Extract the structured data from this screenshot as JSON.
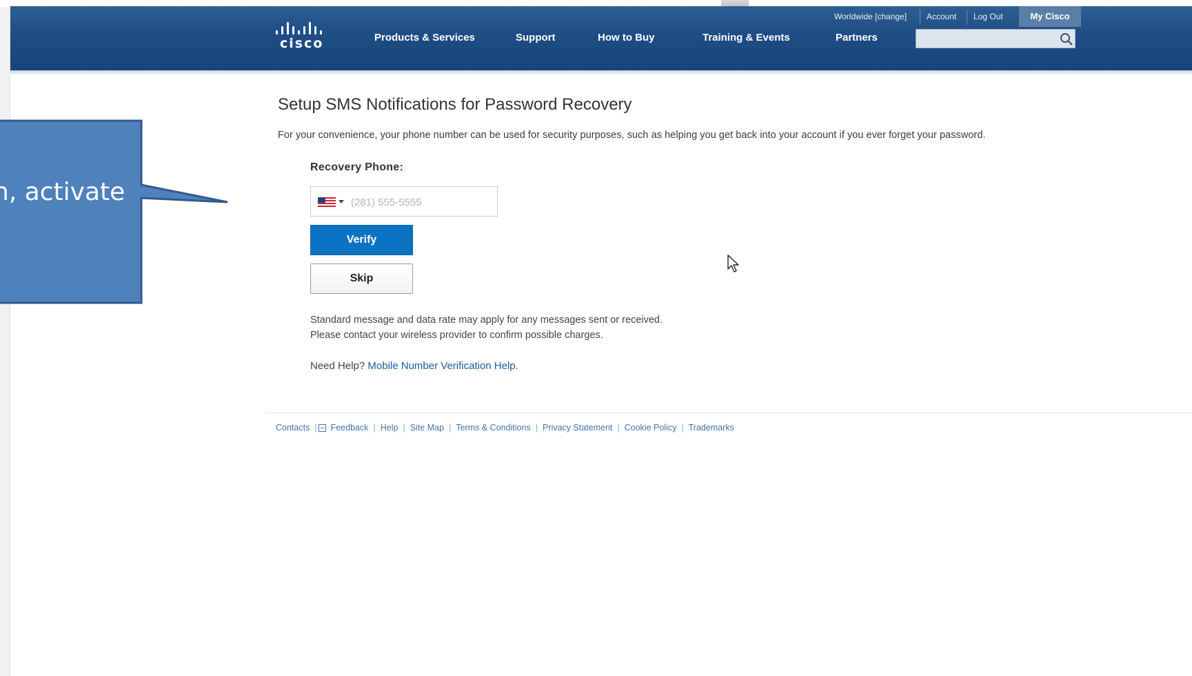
{
  "header": {
    "logo_text": "cisco",
    "nav": [
      "Products & Services",
      "Support",
      "How to Buy",
      "Training & Events",
      "Partners"
    ],
    "utility": {
      "worldwide": "Worldwide [change]",
      "account": "Account",
      "logout": "Log Out",
      "my_cisco": "My Cisco"
    },
    "search": {
      "placeholder": "",
      "icon": "search-icon"
    }
  },
  "main": {
    "title": "Setup SMS Notifications for Password Recovery",
    "intro": "For your convenience, your phone number can be used for security purposes, such as helping you get back into your account if you ever forget your password.",
    "recovery_label": "Recovery Phone:",
    "phone": {
      "placeholder": "(281) 555-5555",
      "country_icon": "us-flag-icon"
    },
    "verify_label": "Verify",
    "skip_label": "Skip",
    "disclaimer_line1": "Standard message and data rate may apply for any messages sent or received.",
    "disclaimer_line2": "Please contact your wireless provider to confirm possible charges.",
    "help_prefix": "Need Help?",
    "help_link": "Mobile Number Verification Help."
  },
  "footer": {
    "links": [
      "Contacts",
      "Feedback",
      "Help",
      "Site Map",
      "Terms & Conditions",
      "Privacy Statement",
      "Cookie Policy",
      "Trademarks"
    ]
  },
  "callout": {
    "text": "n, activate",
    "color": "#4f81bd"
  },
  "colors": {
    "header_blue": "#1e4d85",
    "verify_blue": "#0b73c1",
    "link_blue": "#3f74ad"
  }
}
